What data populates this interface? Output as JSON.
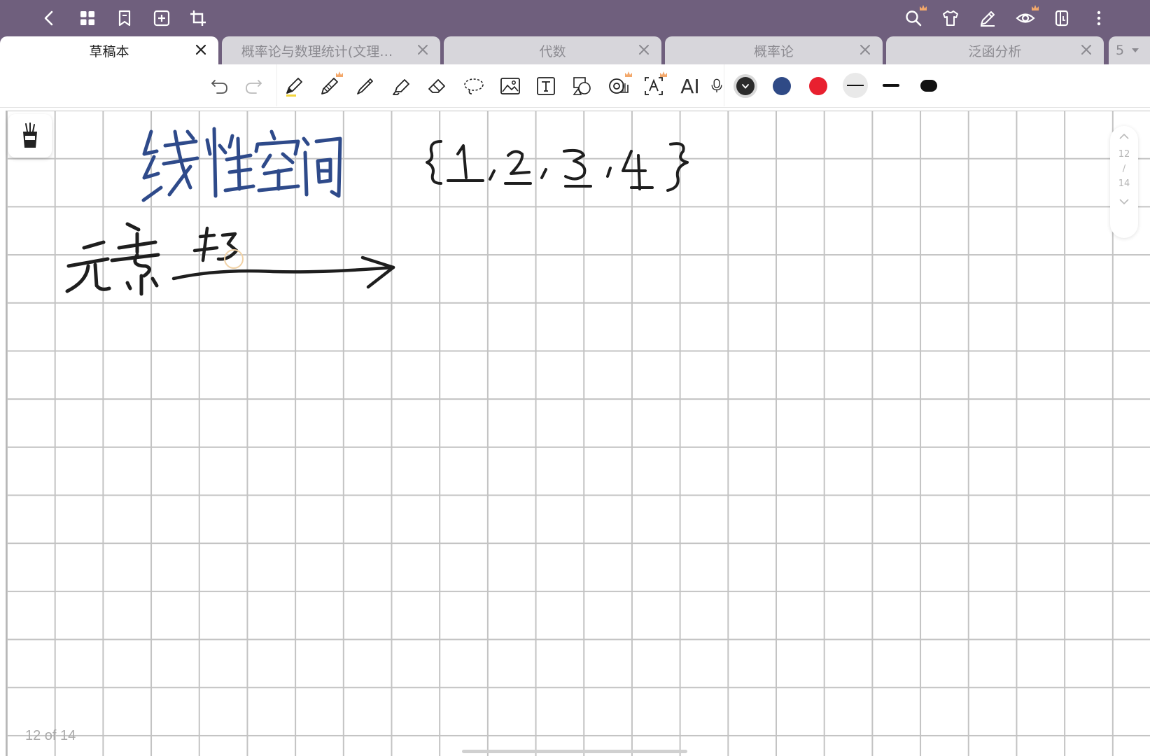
{
  "tabs": [
    {
      "label": "草稿本",
      "active": true
    },
    {
      "label": "概率论与数理统计(文理…",
      "active": false
    },
    {
      "label": "代数",
      "active": false
    },
    {
      "label": "概率论",
      "active": false
    },
    {
      "label": "泛函分析",
      "active": false
    }
  ],
  "tab_count": "5",
  "toolbar": {
    "ai_label": "AI"
  },
  "colors": {
    "topbar": "#6f5f7d",
    "swatch_dark": "#2b2b2b",
    "swatch_blue": "#2f4a86",
    "swatch_red": "#e8202f",
    "ink_blue": "#2e4a8a",
    "ink_black": "#1e1e1e"
  },
  "page_scroller": {
    "current": "12",
    "separator": "/",
    "total": "14"
  },
  "page_indicator": "12 of 14",
  "canvas": {
    "grid": true,
    "handwriting": [
      {
        "text": "线性空间",
        "color": "blue"
      },
      {
        "text": "{1, 2, 3, 4}",
        "color": "black"
      },
      {
        "text": "元素",
        "color": "black"
      },
      {
        "text": "存",
        "color": "black"
      }
    ]
  }
}
